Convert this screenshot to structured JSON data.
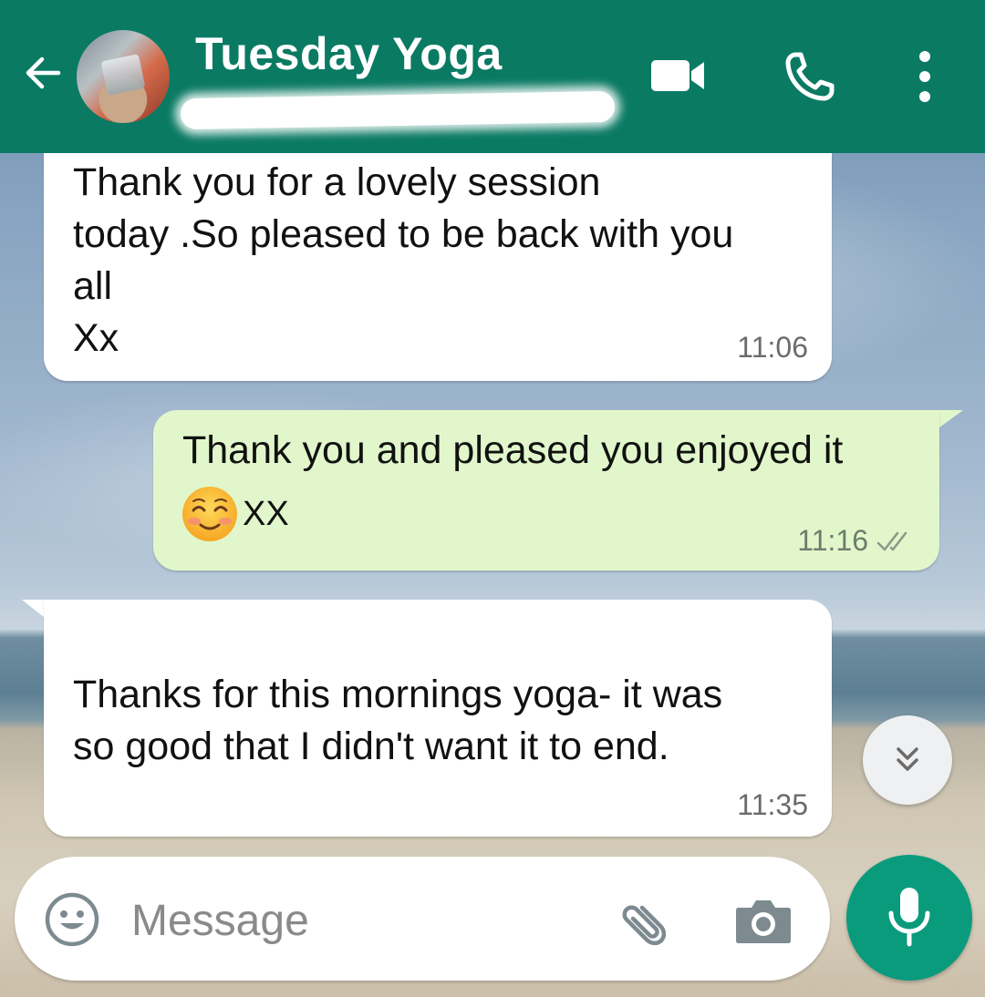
{
  "header": {
    "title": "Tuesday Yoga",
    "back_icon": "back-arrow-icon",
    "actions": [
      "video-call-icon",
      "voice-call-icon",
      "more-options-icon"
    ],
    "color": "#0a7a63"
  },
  "messages": [
    {
      "direction": "incoming",
      "text": "Thank you for a lovely session\ntoday .So pleased to be back with you\nall\nXx",
      "time": "11:06"
    },
    {
      "direction": "outgoing",
      "text": "Thank you and pleased you enjoyed it",
      "emoji": "smiling-face-with-smiling-eyes",
      "text_after_emoji": "XX",
      "time": "11:16",
      "status": "read-double-tick"
    },
    {
      "direction": "incoming",
      "text": "Thanks for this mornings yoga- it was\nso good that I didn't want it to end.",
      "time": "11:35"
    }
  ],
  "composer": {
    "placeholder": "Message",
    "value": "",
    "icons": [
      "emoji-icon",
      "attach-icon",
      "camera-icon",
      "microphone-icon"
    ]
  },
  "colors": {
    "outgoing_bubble": "#e1f7cb",
    "incoming_bubble": "#ffffff",
    "mic_button": "#0a9b7d"
  }
}
